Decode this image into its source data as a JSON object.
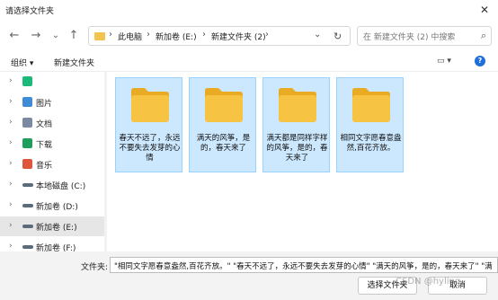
{
  "window": {
    "title": "请选择文件夹",
    "close_glyph": "✕"
  },
  "nav": {
    "back_glyph": "←",
    "forward_glyph": "→",
    "dropdown_glyph": "⌄",
    "up_glyph": "↑",
    "refresh_glyph": "↻",
    "breadcrumb": [
      "此电脑",
      "新加卷 (E:)",
      "新建文件夹 (2)"
    ],
    "chevron_glyph": "›",
    "search_placeholder": "在 新建文件夹 (2) 中搜索",
    "search_glyph": "⌕"
  },
  "toolbar": {
    "organize": "组织 ▾",
    "new_folder": "新建文件夹",
    "view_glyph": "▭ ▾",
    "help_glyph": "?"
  },
  "sidebar": {
    "items": [
      {
        "label": "",
        "icon": "app-icon",
        "color": "#1db97a"
      },
      {
        "label": "图片",
        "icon": "pictures-icon",
        "color": "#3f8bd6"
      },
      {
        "label": "文档",
        "icon": "documents-icon",
        "color": "#7a8aa0"
      },
      {
        "label": "下载",
        "icon": "downloads-icon",
        "color": "#1e9e5a"
      },
      {
        "label": "音乐",
        "icon": "music-icon",
        "color": "#e0563a"
      },
      {
        "label": "本地磁盘 (C:)",
        "icon": "drive-icon",
        "color": "#5a6b7c"
      },
      {
        "label": "新加卷 (D:)",
        "icon": "drive-icon",
        "color": "#5a6b7c"
      },
      {
        "label": "新加卷 (E:)",
        "icon": "drive-icon",
        "color": "#5a6b7c"
      },
      {
        "label": "新加卷 (F:)",
        "icon": "drive-icon",
        "color": "#5a6b7c"
      }
    ]
  },
  "files": [
    {
      "name": "春天不远了，永远不要失去发芽的心情"
    },
    {
      "name": "满天的风筝，是的，春天来了"
    },
    {
      "name": "满天都是同样字样的风筝，是的，春天来了"
    },
    {
      "name": "相同文字愿春意盎然,百花齐放。"
    }
  ],
  "bottom": {
    "filename_label": "文件夹:",
    "filename_value": "\"相同文字愿春意盎然,百花齐放。\" \"春天不远了，永远不要失去发芽的心情\" \"满天的风筝，是的，春天来了\" \"满",
    "select_button": "选择文件夹",
    "cancel_button": "取消"
  },
  "watermark": "CSDN @hyling",
  "colors": {
    "folder": "#f6c343",
    "folder_dark": "#e9ab23",
    "selection": "#cce8ff",
    "accent": "#1e6fd9"
  }
}
